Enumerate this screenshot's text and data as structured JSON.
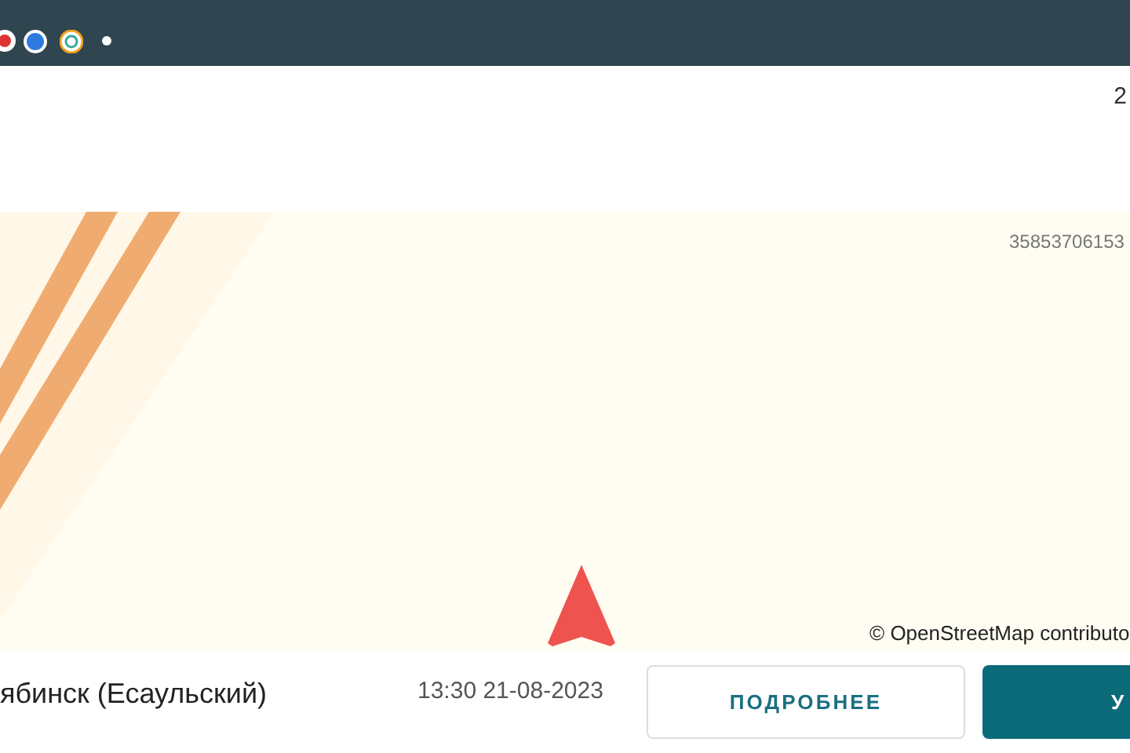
{
  "header": {
    "corner_text": "2"
  },
  "map": {
    "vehicle_id": "35853706153",
    "attribution": "© OpenStreetMap contributo"
  },
  "footer": {
    "location": "ябинск (Есаульский)",
    "timestamp": "13:30 21-08-2023",
    "buttons": [
      {
        "label": "ПОДРОБНЕЕ",
        "kind": "outline"
      },
      {
        "label": "У",
        "kind": "filled"
      }
    ]
  }
}
